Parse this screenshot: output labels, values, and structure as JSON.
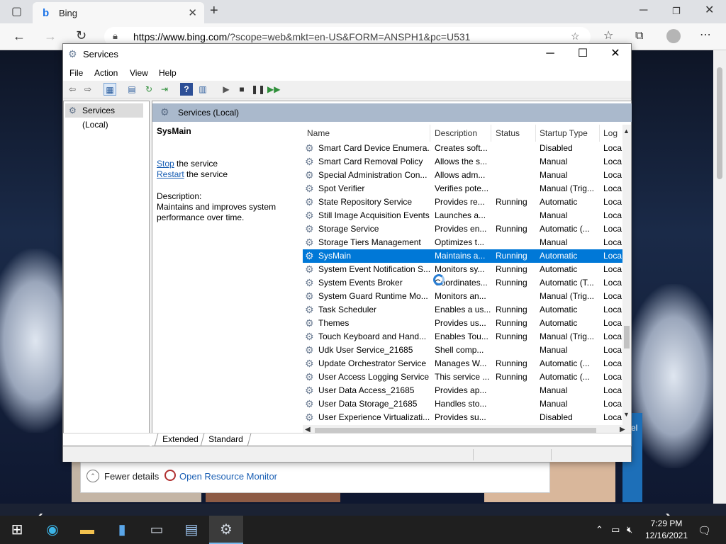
{
  "browser": {
    "tab_title": "Bing",
    "tab_favicon": "b",
    "url_domain": "https://www.bing.com",
    "url_path": "/?scope=web&mkt=en-US&FORM=ANSPH1&pc=U531"
  },
  "background_page": {
    "task_manager": {
      "fewer_details": "Fewer details",
      "open_resource_monitor": "Open Resource Monitor"
    },
    "carousel_caption": "el"
  },
  "window": {
    "title": "Services",
    "menu": [
      "File",
      "Action",
      "View",
      "Help"
    ],
    "tree_node": "Services (Local)",
    "pane_header": "Services (Local)",
    "detail": {
      "service_name": "SysMain",
      "stop_link": "Stop",
      "stop_suffix": " the service",
      "restart_link": "Restart",
      "restart_suffix": " the service",
      "description_label": "Description:",
      "description_text": "Maintains and improves system performance over time."
    },
    "columns": [
      "Name",
      "Description",
      "Status",
      "Startup Type",
      "Log"
    ],
    "rows": [
      {
        "name": "Smart Card Device Enumera...",
        "description": "Creates soft...",
        "status": "",
        "startup": "Disabled",
        "log": "Loca"
      },
      {
        "name": "Smart Card Removal Policy",
        "description": "Allows the s...",
        "status": "",
        "startup": "Manual",
        "log": "Loca"
      },
      {
        "name": "Special Administration Con...",
        "description": "Allows adm...",
        "status": "",
        "startup": "Manual",
        "log": "Loca"
      },
      {
        "name": "Spot Verifier",
        "description": "Verifies pote...",
        "status": "",
        "startup": "Manual (Trig...",
        "log": "Loca"
      },
      {
        "name": "State Repository Service",
        "description": "Provides re...",
        "status": "Running",
        "startup": "Automatic",
        "log": "Loca"
      },
      {
        "name": "Still Image Acquisition Events",
        "description": "Launches a...",
        "status": "",
        "startup": "Manual",
        "log": "Loca"
      },
      {
        "name": "Storage Service",
        "description": "Provides en...",
        "status": "Running",
        "startup": "Automatic (...",
        "log": "Loca"
      },
      {
        "name": "Storage Tiers Management",
        "description": "Optimizes t...",
        "status": "",
        "startup": "Manual",
        "log": "Loca"
      },
      {
        "name": "SysMain",
        "description": "Maintains a...",
        "status": "Running",
        "startup": "Automatic",
        "log": "Loca",
        "selected": true
      },
      {
        "name": "System Event Notification S...",
        "description": "Monitors sy...",
        "status": "Running",
        "startup": "Automatic",
        "log": "Loca"
      },
      {
        "name": "System Events Broker",
        "description": "Coordinates...",
        "status": "Running",
        "startup": "Automatic (T...",
        "log": "Loca"
      },
      {
        "name": "System Guard Runtime Mo...",
        "description": "Monitors an...",
        "status": "",
        "startup": "Manual (Trig...",
        "log": "Loca"
      },
      {
        "name": "Task Scheduler",
        "description": "Enables a us...",
        "status": "Running",
        "startup": "Automatic",
        "log": "Loca"
      },
      {
        "name": "Themes",
        "description": "Provides us...",
        "status": "Running",
        "startup": "Automatic",
        "log": "Loca"
      },
      {
        "name": "Touch Keyboard and Hand...",
        "description": "Enables Tou...",
        "status": "Running",
        "startup": "Manual (Trig...",
        "log": "Loca"
      },
      {
        "name": "Udk User Service_21685",
        "description": "Shell comp...",
        "status": "",
        "startup": "Manual",
        "log": "Loca"
      },
      {
        "name": "Update Orchestrator Service",
        "description": "Manages W...",
        "status": "Running",
        "startup": "Automatic (...",
        "log": "Loca"
      },
      {
        "name": "User Access Logging Service",
        "description": "This service ...",
        "status": "Running",
        "startup": "Automatic (...",
        "log": "Loca"
      },
      {
        "name": "User Data Access_21685",
        "description": "Provides ap...",
        "status": "",
        "startup": "Manual",
        "log": "Loca"
      },
      {
        "name": "User Data Storage_21685",
        "description": "Handles sto...",
        "status": "",
        "startup": "Manual",
        "log": "Loca"
      },
      {
        "name": "User Experience Virtualizati...",
        "description": "Provides su...",
        "status": "",
        "startup": "Disabled",
        "log": "Loca"
      }
    ],
    "view_tabs": [
      "Extended",
      "Standard"
    ]
  },
  "taskbar": {
    "time": "7:29 PM",
    "date": "12/16/2021"
  },
  "colors": {
    "selection": "#0078d7",
    "pane_header": "#aab9cc",
    "link": "#1a5fb4",
    "taskbar": "#1f1f1f"
  }
}
